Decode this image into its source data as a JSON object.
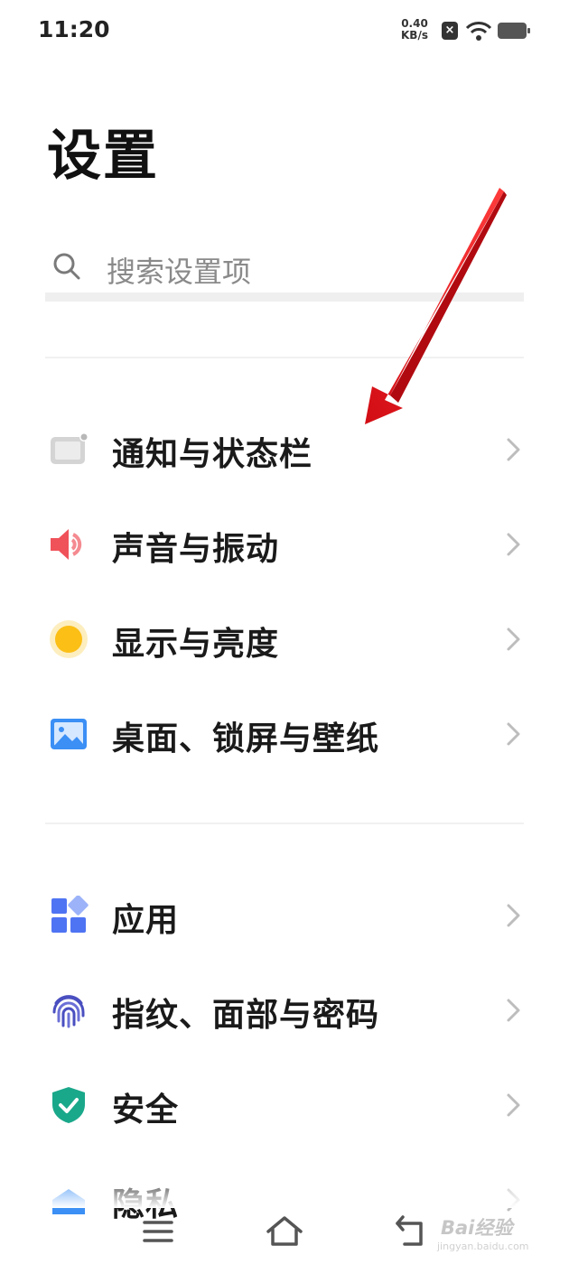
{
  "status_bar": {
    "time": "11:20",
    "net_speed_value": "0.40",
    "net_speed_unit": "KB/s",
    "icons": [
      "notification-x-icon",
      "wifi-icon",
      "battery-icon"
    ]
  },
  "page_title": "设置",
  "search": {
    "placeholder": "搜索设置项"
  },
  "groups": [
    {
      "items": [
        {
          "label": "通知与状态栏",
          "icon": "notification-statusbar-icon"
        },
        {
          "label": "声音与振动",
          "icon": "speaker-icon"
        },
        {
          "label": "显示与亮度",
          "icon": "brightness-icon"
        },
        {
          "label": "桌面、锁屏与壁纸",
          "icon": "wallpaper-icon"
        }
      ]
    },
    {
      "items": [
        {
          "label": "应用",
          "icon": "apps-icon"
        },
        {
          "label": "指纹、面部与密码",
          "icon": "fingerprint-icon"
        },
        {
          "label": "安全",
          "icon": "shield-check-icon"
        },
        {
          "label": "隐私",
          "icon": "privacy-icon"
        }
      ]
    }
  ],
  "annotation": {
    "color": "#e8131b",
    "type": "red-arrow-icon"
  },
  "nav_bar": [
    "menu-icon",
    "home-icon",
    "back-icon"
  ],
  "watermark": {
    "text": "Bai经验",
    "sub": "jingyan.baidu.com"
  },
  "colors": {
    "speaker_red": "#f0525a",
    "brightness_yellow": "#fbbf16",
    "wallpaper_blue": "#3b8ff5",
    "apps_blue": "#4f74f3",
    "fingerprint_indigo": "#4a4fc0",
    "shield_teal": "#1aa88a"
  }
}
